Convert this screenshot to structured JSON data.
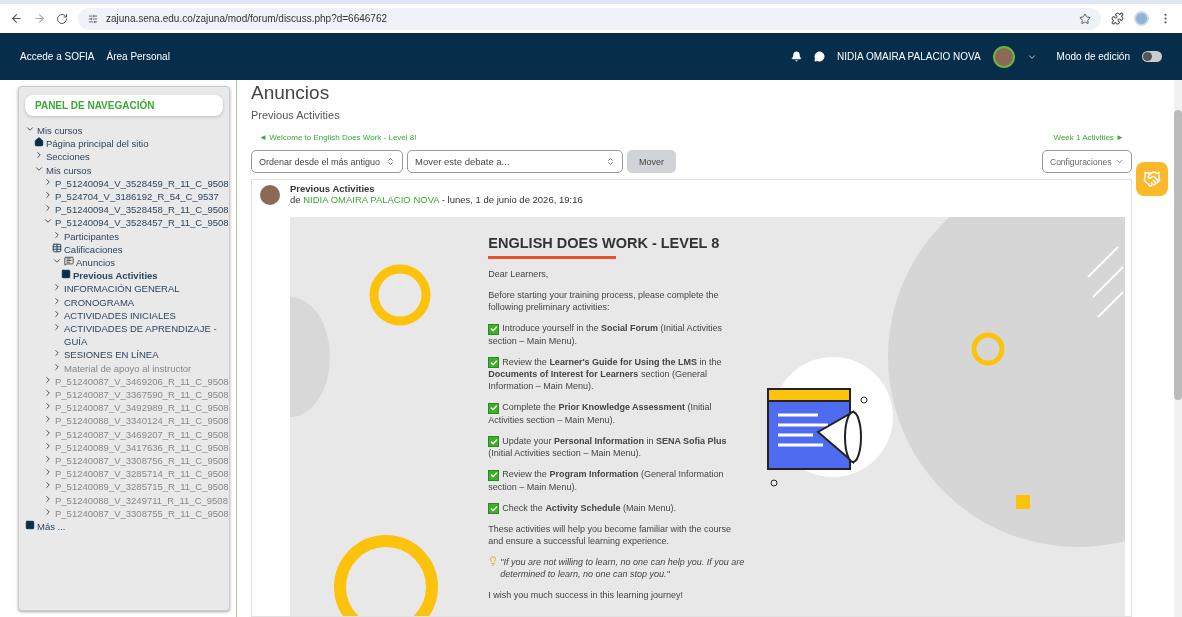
{
  "browser": {
    "url": "zajuna.sena.edu.co/zajuna/mod/forum/discuss.php?d=6646762"
  },
  "navbar": {
    "links": [
      "Accede a SOFIA",
      "Área Personal"
    ],
    "user": "NIDIA OMAIRA PALACIO NOVA",
    "edit_mode": {
      "label": "Modo de edición",
      "on": false
    }
  },
  "sidebar": {
    "title": "PANEL DE NAVEGACIÓN",
    "tree": [
      {
        "label": "Mis cursos",
        "kind": "branch",
        "expanded": true,
        "selected": false,
        "dimmed": false,
        "children": [
          {
            "label": "Página principal del sitio",
            "kind": "home",
            "selected": false,
            "dimmed": false
          },
          {
            "label": "Secciones",
            "kind": "branch",
            "expanded": false,
            "selected": false,
            "dimmed": false
          },
          {
            "label": "Mis cursos",
            "kind": "branch",
            "expanded": true,
            "selected": false,
            "dimmed": false,
            "children": [
              {
                "label": "P_51240094_V_3528459_R_11_C_9508",
                "kind": "branch",
                "expanded": false,
                "selected": false,
                "dimmed": false
              },
              {
                "label": "P_524704_V_3186192_R_54_C_9537",
                "kind": "branch",
                "expanded": false,
                "selected": false,
                "dimmed": false
              },
              {
                "label": "P_51240094_V_3528458_R_11_C_9508",
                "kind": "branch",
                "expanded": false,
                "selected": false,
                "dimmed": false
              },
              {
                "label": "P_51240094_V_3528457_R_11_C_9508",
                "kind": "branch",
                "expanded": true,
                "selected": false,
                "dimmed": false,
                "children": [
                  {
                    "label": "Participantes",
                    "kind": "branch",
                    "expanded": false,
                    "selected": false,
                    "dimmed": false
                  },
                  {
                    "label": "Calificaciones",
                    "kind": "grades",
                    "selected": false,
                    "dimmed": false
                  },
                  {
                    "label": "Anuncios",
                    "kind": "forum",
                    "expanded": true,
                    "selected": false,
                    "dimmed": false,
                    "children": [
                      {
                        "label": "Previous Activities",
                        "kind": "page",
                        "selected": true,
                        "dimmed": false
                      }
                    ]
                  },
                  {
                    "label": "INFORMACIÓN GENERAL",
                    "kind": "branch",
                    "expanded": false,
                    "selected": false,
                    "dimmed": false
                  },
                  {
                    "label": "CRONOGRAMA",
                    "kind": "branch",
                    "expanded": false,
                    "selected": false,
                    "dimmed": false
                  },
                  {
                    "label": "ACTIVIDADES INICIALES",
                    "kind": "branch",
                    "expanded": false,
                    "selected": false,
                    "dimmed": false
                  },
                  {
                    "label": "ACTIVIDADES DE APRENDIZAJE - GUÍA",
                    "kind": "branch",
                    "expanded": false,
                    "selected": false,
                    "dimmed": false
                  },
                  {
                    "label": "SESIONES EN LÍNEA",
                    "kind": "branch",
                    "expanded": false,
                    "selected": false,
                    "dimmed": false
                  },
                  {
                    "label": "Material de apoyo al instructor",
                    "kind": "branch",
                    "expanded": false,
                    "selected": false,
                    "dimmed": true
                  }
                ]
              },
              {
                "label": "P_51240087_V_3469206_R_11_C_9508",
                "kind": "branch",
                "expanded": false,
                "selected": false,
                "dimmed": true
              },
              {
                "label": "P_51240087_V_3367590_R_11_C_9508",
                "kind": "branch",
                "expanded": false,
                "selected": false,
                "dimmed": true
              },
              {
                "label": "P_51240087_V_3492989_R_11_C_9508",
                "kind": "branch",
                "expanded": false,
                "selected": false,
                "dimmed": true
              },
              {
                "label": "P_51240088_V_3340124_R_11_C_9508",
                "kind": "branch",
                "expanded": false,
                "selected": false,
                "dimmed": true
              },
              {
                "label": "P_51240087_V_3469207_R_11_C_9508",
                "kind": "branch",
                "expanded": false,
                "selected": false,
                "dimmed": true
              },
              {
                "label": "P_51240089_V_3417636_R_11_C_9508",
                "kind": "branch",
                "expanded": false,
                "selected": false,
                "dimmed": true
              },
              {
                "label": "P_51240087_V_3308756_R_11_C_9508",
                "kind": "branch",
                "expanded": false,
                "selected": false,
                "dimmed": true
              },
              {
                "label": "P_51240087_V_3285714_R_11_C_9508",
                "kind": "branch",
                "expanded": false,
                "selected": false,
                "dimmed": true
              },
              {
                "label": "P_51240089_V_3285715_R_11_C_9508",
                "kind": "branch",
                "expanded": false,
                "selected": false,
                "dimmed": true
              },
              {
                "label": "P_51240088_V_3249711_R_11_C_9508",
                "kind": "branch",
                "expanded": false,
                "selected": false,
                "dimmed": true
              },
              {
                "label": "P_51240087_V_3308755_R_11_C_9508",
                "kind": "branch",
                "expanded": false,
                "selected": false,
                "dimmed": true
              }
            ]
          }
        ]
      },
      {
        "label": "Más ...",
        "kind": "page",
        "selected": false,
        "dimmed": false
      }
    ]
  },
  "main": {
    "title": "Anuncios",
    "subtitle": "Previous Activities",
    "prev_link": {
      "arrow": "◄",
      "label": "Welcome to English Does Work - Level 8!"
    },
    "next_link": {
      "arrow": "►",
      "label": "Week 1 Activities"
    },
    "sort_select": "Ordenar desde el más antiguo",
    "move_select": "Mover este debate a...",
    "move_button": {
      "label": "Mover",
      "disabled": true
    },
    "settings": "Configuraciones",
    "post": {
      "title": "Previous Activities",
      "by": "de",
      "author": "NIDIA OMAIRA PALACIO NOVA",
      "date": "- lunes, 1 de junio de 2026, 19:16",
      "heading": "ENGLISH DOES WORK - LEVEL 8",
      "greeting": "Dear Learners,",
      "intro": "Before starting your training process, please complete the following preliminary activities:",
      "checklist": [
        {
          "text": "Introduce yourself in the **Social Forum** (Initial Activities section – Main Menu).",
          "checked": true
        },
        {
          "text": "Review the **Learner's Guide for Using the LMS** in the **Documents of Interest for Learners** section (General Information – Main Menu).",
          "checked": true
        },
        {
          "text": "Complete the **Prior Knowledge Assessment** (Initial Activities section – Main Menu).",
          "checked": true
        },
        {
          "text": "Update your **Personal Information** in **SENA Sofia Plus** (Initial Activities section – Main Menu).",
          "checked": true
        },
        {
          "text": "Review the **Program Information** (General Information section – Main Menu).",
          "checked": true
        },
        {
          "text": "Check the **Activity Schedule** (Main Menu).",
          "checked": true
        }
      ],
      "closing": "These activities will help you become familiar with the course and ensure a successful learning experience.",
      "quote": "\"If you are not willing to learn, no one can help you. If you are determined to learn, no one can stop you.\"",
      "farewell": "I wish you much success in this learning journey!"
    }
  }
}
